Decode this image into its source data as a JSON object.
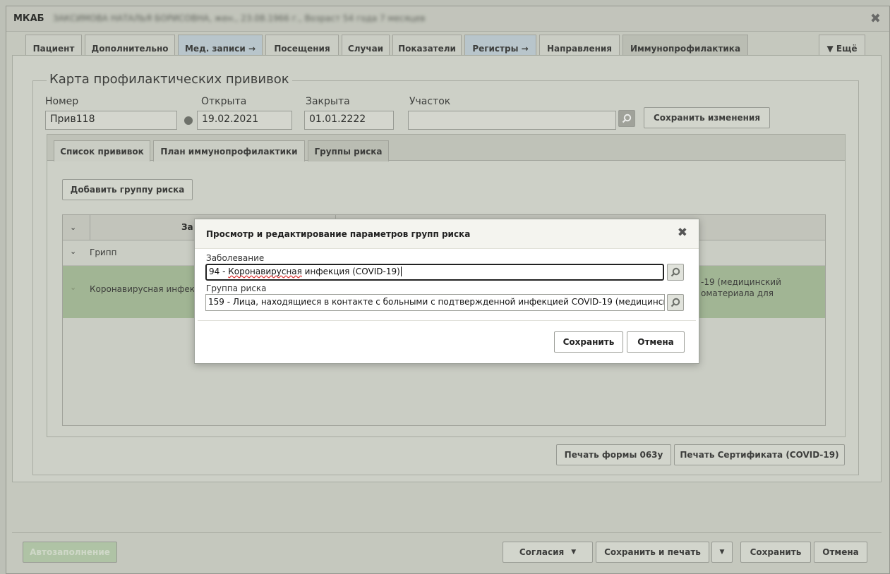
{
  "window": {
    "title": "МКАБ",
    "patient_blurred": "ЗАКСИМОВА НАТАЛЬЯ БОРИСОВНА, жен., 23.08.1966 г., Возраст 54 года 7 месяцев"
  },
  "main_tabs": [
    {
      "label": "Пациент"
    },
    {
      "label": "Дополнительно"
    },
    {
      "label": "Мед. записи →"
    },
    {
      "label": "Посещения"
    },
    {
      "label": "Случаи"
    },
    {
      "label": "Показатели"
    },
    {
      "label": "Регистры →"
    },
    {
      "label": "Направления"
    },
    {
      "label": "Иммунопрофилактика"
    }
  ],
  "more_tab": "▼ Ещё",
  "card": {
    "title": "Карта профилактических прививок",
    "number_label": "Номер",
    "number_value": "Прив118",
    "opened_label": "Открыта",
    "opened_value": "19.02.2021",
    "closed_label": "Закрыта",
    "closed_value": "01.01.2222",
    "district_label": "Участок",
    "district_value": "",
    "save_changes": "Сохранить изменения"
  },
  "sub_tabs": [
    {
      "label": "Список прививок"
    },
    {
      "label": "План иммунопрофилактики"
    },
    {
      "label": "Группы риска"
    }
  ],
  "add_risk_group": "Добавить группу риска",
  "grid": {
    "header_col1": "За",
    "rows": [
      {
        "label": "Грипп"
      },
      {
        "label": "Коронавирусная инфек",
        "right_text_1": "-19 (медицинский",
        "right_text_2": "оматериала для"
      }
    ]
  },
  "print_buttons": {
    "form": "Печать формы 063у",
    "certificate": "Печать Сертификата (COVID-19)"
  },
  "dialog": {
    "title": "Просмотр и редактирование параметров групп риска",
    "disease_label": "Заболевание",
    "disease_prefix": "94 - ",
    "disease_word": "Коронавирусная",
    "disease_suffix": " инфекция (COVID-19)",
    "risk_label": "Группа риска",
    "risk_value": "159 - Лица, находящиеся в контакте с больными с подтвержденной инфекцией COVID-19 (медицинск",
    "save": "Сохранить",
    "cancel": "Отмена"
  },
  "bottom": {
    "autofill": "Автозаполнение",
    "consents": "Согласия",
    "save_print": "Сохранить и печать",
    "save": "Сохранить",
    "cancel": "Отмена"
  },
  "colors": {
    "selected_row": "#a9bf9a",
    "blue_tab": "#c3d2db"
  }
}
